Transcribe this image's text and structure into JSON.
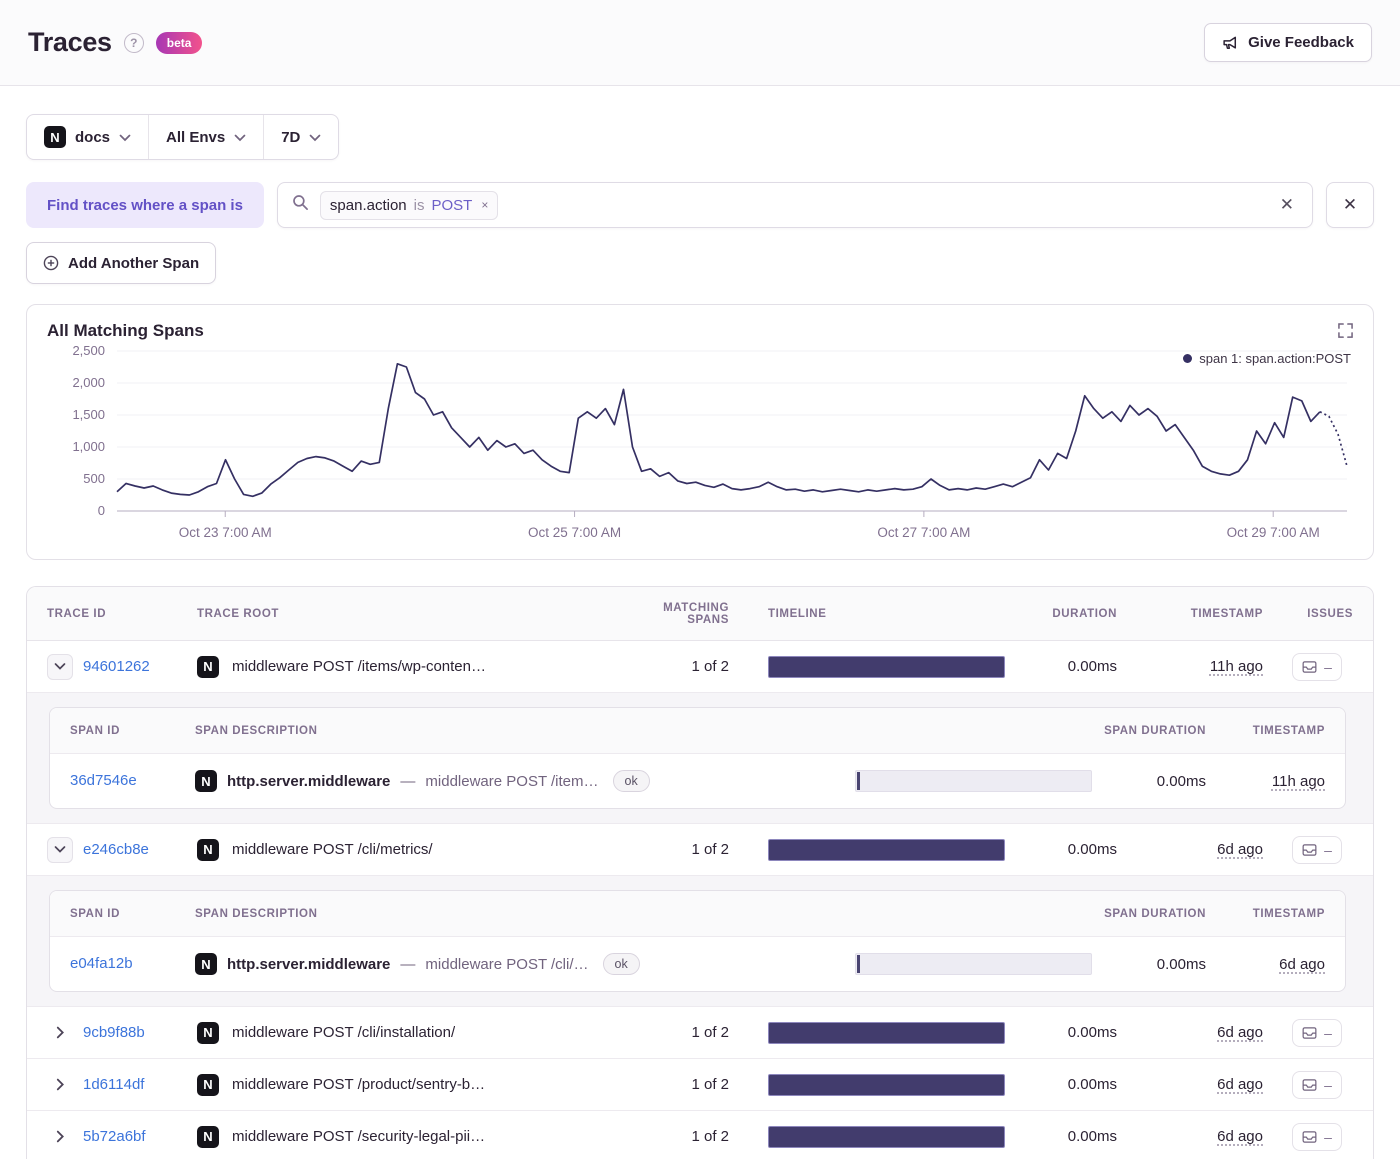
{
  "header": {
    "title": "Traces",
    "beta_label": "beta",
    "feedback_label": "Give Feedback"
  },
  "filters": {
    "project": "docs",
    "environment": "All Envs",
    "period": "7D"
  },
  "project_logo_letter": "N",
  "query": {
    "where_label": "Find traces where a span is",
    "token": {
      "key": "span.action",
      "op": "is",
      "value": "POST",
      "remove": "×"
    },
    "clear_label": "✕",
    "remove_label": "✕",
    "add_span_label": "Add Another Span"
  },
  "chart": {
    "title": "All Matching Spans",
    "legend": "span 1: span.action:POST"
  },
  "chart_data": {
    "type": "line",
    "title": "All Matching Spans",
    "legend": [
      "span 1: span.action:POST"
    ],
    "ylim": [
      0,
      2500
    ],
    "yticks": [
      0,
      500,
      1000,
      1500,
      2000,
      2500
    ],
    "ytick_labels": [
      "0",
      "500",
      "1,000",
      "1,500",
      "2,000",
      "2,500"
    ],
    "x_ticks": [
      {
        "frac": 0.088,
        "label": "Oct 23 7:00 AM"
      },
      {
        "frac": 0.372,
        "label": "Oct 25 7:00 AM"
      },
      {
        "frac": 0.656,
        "label": "Oct 27 7:00 AM"
      },
      {
        "frac": 0.94,
        "label": "Oct 29 7:00 AM"
      }
    ],
    "dashed_tail_points": 3,
    "values": [
      300,
      430,
      390,
      360,
      390,
      330,
      280,
      260,
      250,
      300,
      380,
      430,
      800,
      500,
      260,
      230,
      280,
      420,
      520,
      640,
      760,
      820,
      850,
      830,
      780,
      700,
      620,
      780,
      730,
      760,
      1600,
      2300,
      2250,
      1850,
      1750,
      1500,
      1550,
      1300,
      1150,
      1000,
      1150,
      950,
      1100,
      1000,
      1050,
      900,
      950,
      800,
      700,
      620,
      600,
      1450,
      1550,
      1450,
      1600,
      1350,
      1900,
      1000,
      620,
      660,
      540,
      600,
      470,
      430,
      450,
      400,
      370,
      420,
      350,
      330,
      350,
      380,
      450,
      380,
      330,
      340,
      310,
      330,
      300,
      320,
      340,
      320,
      300,
      330,
      310,
      330,
      350,
      330,
      340,
      380,
      500,
      400,
      330,
      350,
      330,
      360,
      340,
      380,
      420,
      380,
      450,
      520,
      800,
      640,
      900,
      820,
      1250,
      1800,
      1600,
      1450,
      1550,
      1400,
      1650,
      1500,
      1600,
      1480,
      1250,
      1350,
      1150,
      950,
      700,
      620,
      580,
      560,
      620,
      800,
      1250,
      1050,
      1380,
      1150,
      1780,
      1720,
      1400,
      1550,
      1480,
      1200,
      700
    ]
  },
  "colors": {
    "accent_purple": "#6C5FC7",
    "link_blue": "#3C74DB",
    "timeline_bar": "#423C6D",
    "chart_line": "#353063",
    "beta_gradient_start": "#A737B4",
    "beta_gradient_end": "#F2528C"
  },
  "table": {
    "headers": {
      "trace_id": "TRACE ID",
      "trace_root": "TRACE ROOT",
      "matching": "MATCHING SPANS",
      "timeline": "TIMELINE",
      "duration": "DURATION",
      "timestamp": "TIMESTAMP",
      "issues": "ISSUES"
    },
    "span_headers": {
      "id": "SPAN ID",
      "desc": "SPAN DESCRIPTION",
      "duration": "SPAN DURATION",
      "timestamp": "TIMESTAMP"
    },
    "desc_separator": "—",
    "issues_empty": "–",
    "rows": [
      {
        "id": "94601262",
        "root": "middleware POST /items/wp-conten…",
        "matching": "1 of 2",
        "duration": "0.00ms",
        "age": "11h ago",
        "spans": [
          {
            "id": "36d7546e",
            "op": "http.server.middleware",
            "desc": "middleware POST /item…",
            "status": "ok",
            "duration": "0.00ms",
            "age": "11h ago"
          }
        ]
      },
      {
        "id": "e246cb8e",
        "root": "middleware POST /cli/metrics/",
        "matching": "1 of 2",
        "duration": "0.00ms",
        "age": "6d ago",
        "spans": [
          {
            "id": "e04fa12b",
            "op": "http.server.middleware",
            "desc": "middleware POST /cli/…",
            "status": "ok",
            "duration": "0.00ms",
            "age": "6d ago"
          }
        ]
      },
      {
        "id": "9cb9f88b",
        "root": "middleware POST /cli/installation/",
        "matching": "1 of 2",
        "duration": "0.00ms",
        "age": "6d ago"
      },
      {
        "id": "1d6114df",
        "root": "middleware POST /product/sentry-b…",
        "matching": "1 of 2",
        "duration": "0.00ms",
        "age": "6d ago"
      },
      {
        "id": "5b72a6bf",
        "root": "middleware POST /security-legal-pii…",
        "matching": "1 of 2",
        "duration": "0.00ms",
        "age": "6d ago"
      }
    ]
  }
}
